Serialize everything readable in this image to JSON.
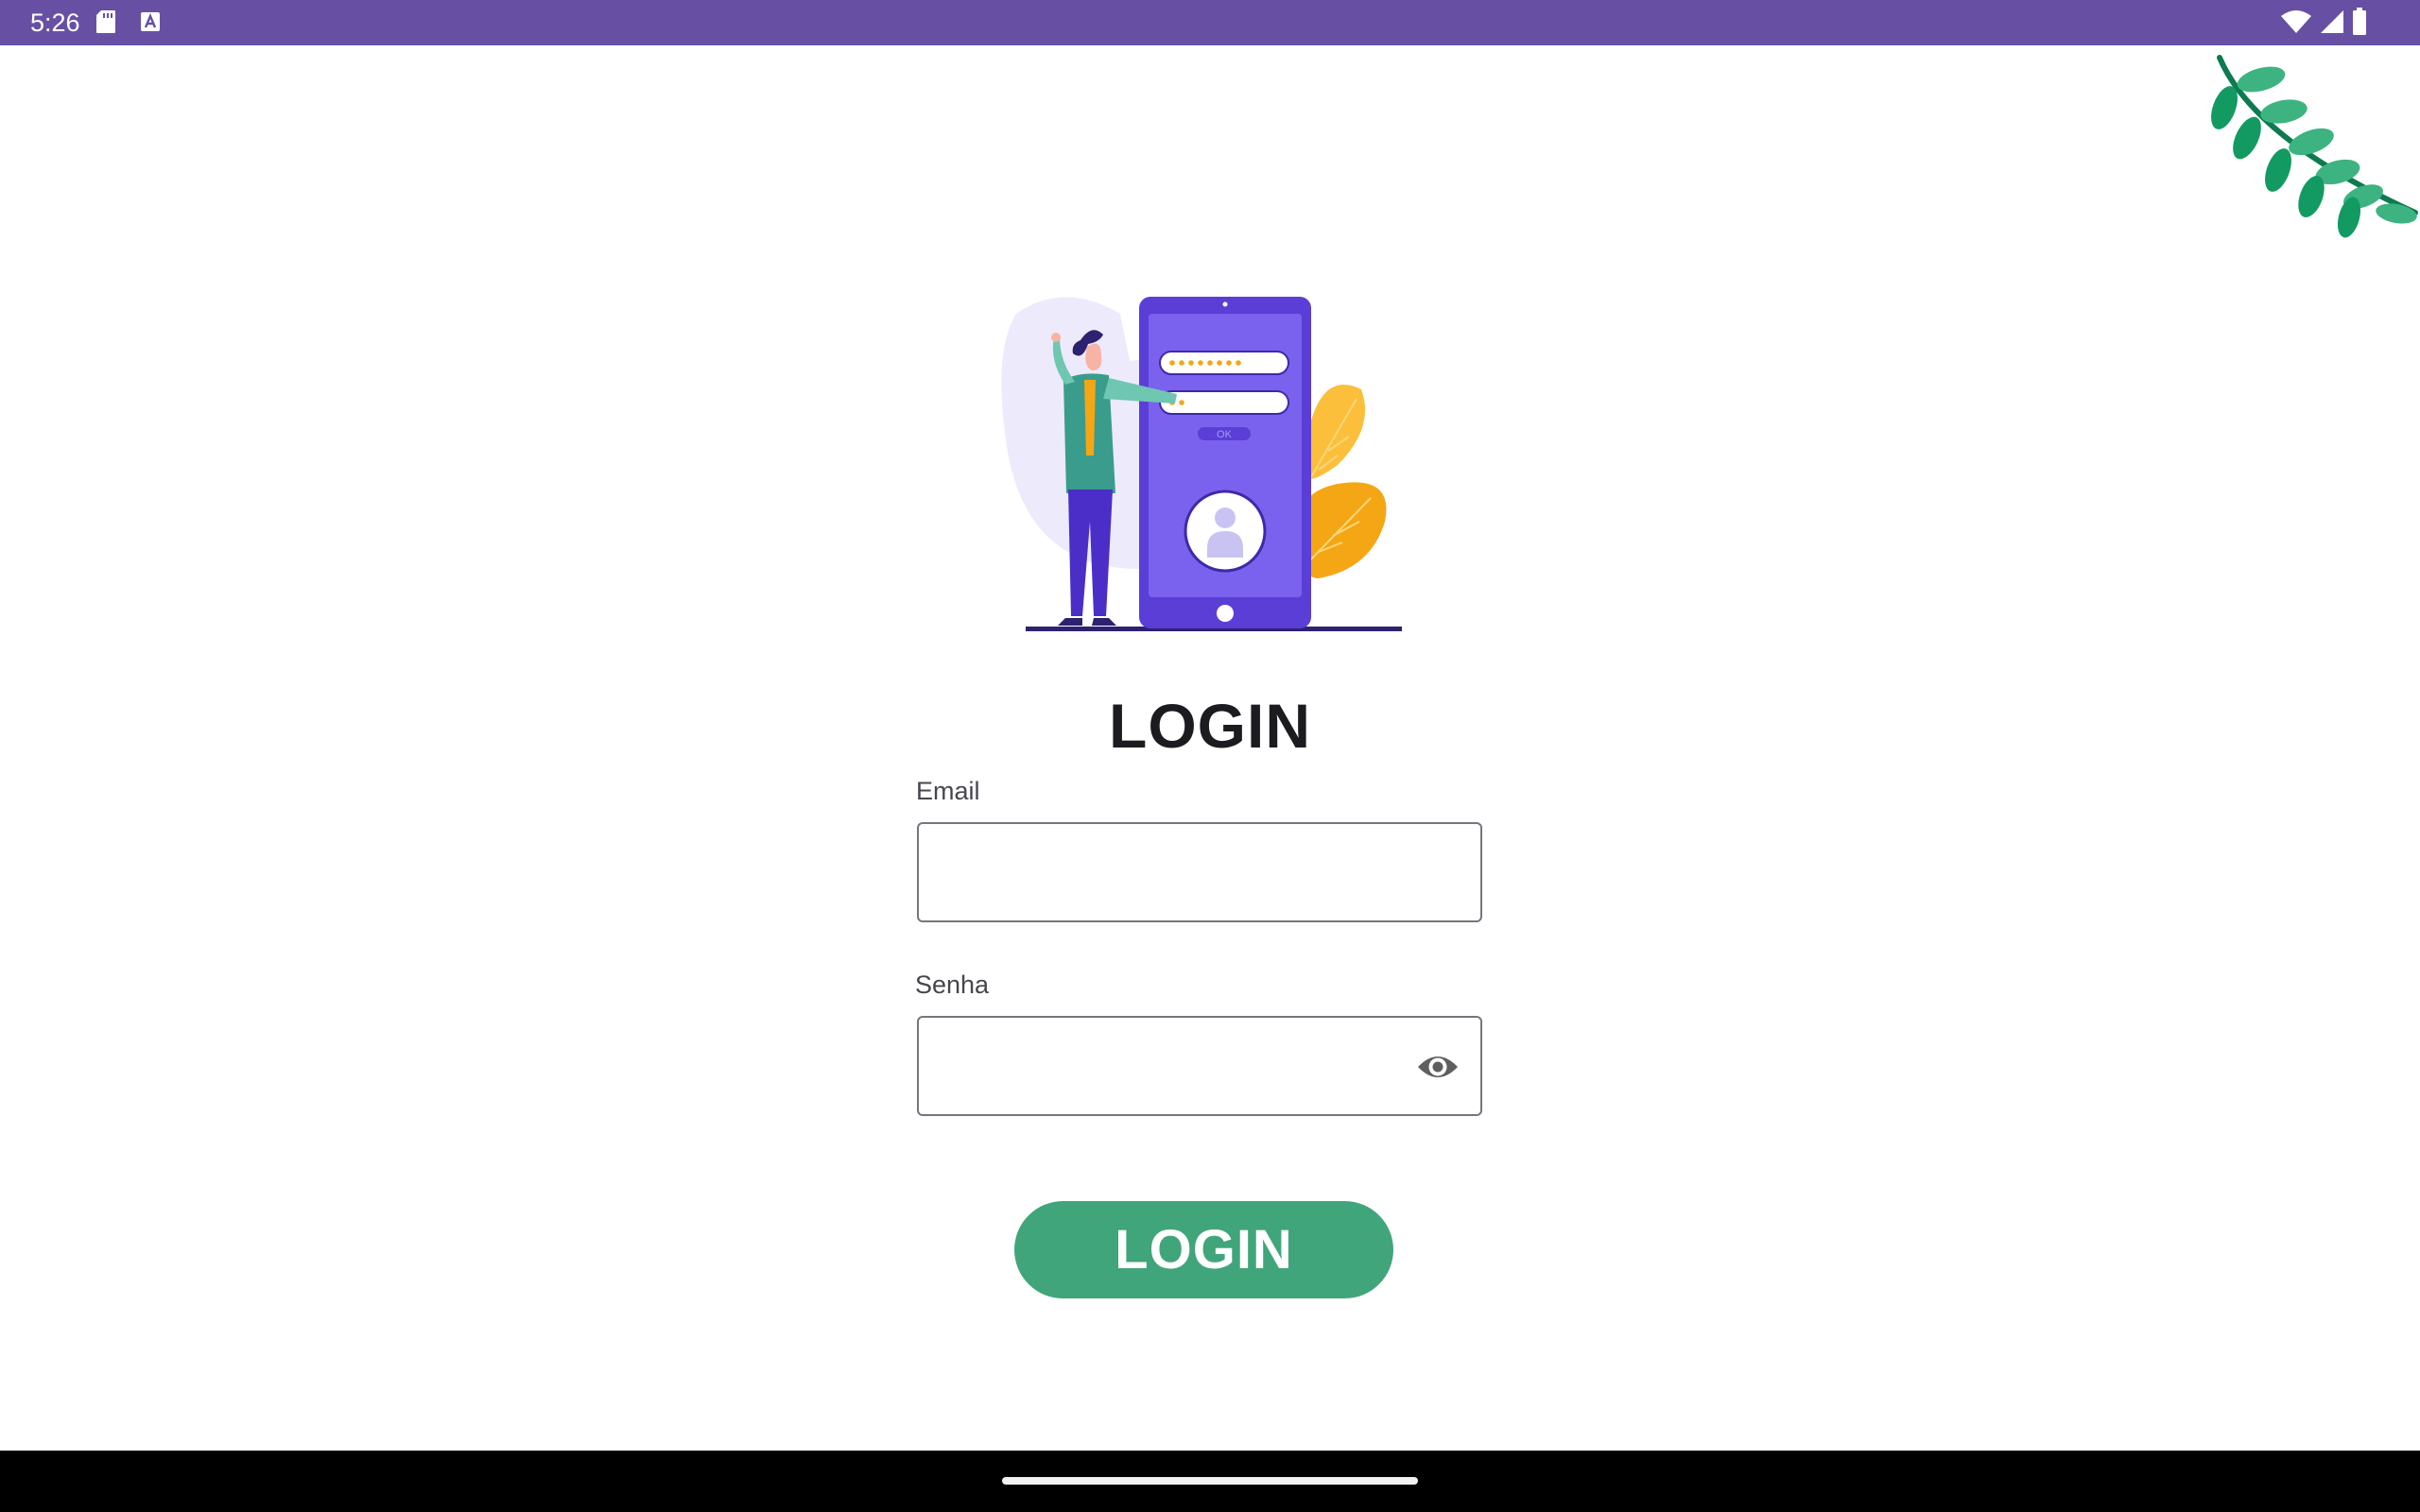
{
  "status_bar": {
    "time": "5:26",
    "left_icons": [
      "sd-card-icon",
      "keyboard-a-icon"
    ],
    "right_icons": [
      "wifi-icon",
      "cell-signal-icon",
      "battery-icon"
    ],
    "background_color": "#6750a4"
  },
  "illustration": {
    "phone_button_label": "OK"
  },
  "login": {
    "title": "LOGIN",
    "email_label": "Email",
    "email_value": "",
    "password_label": "Senha",
    "password_value": "",
    "password_toggle_icon": "eye-icon",
    "button_label": "LOGIN",
    "button_color": "#41a57b"
  },
  "nav_bar": {
    "background_color": "#000000"
  }
}
